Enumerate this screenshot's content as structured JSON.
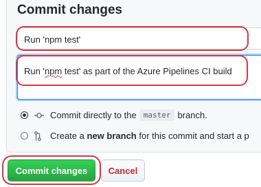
{
  "form": {
    "title": "Commit changes",
    "summary_value": "Run 'npm test'",
    "description_prefix": "Run '",
    "description_misspelled": "npm",
    "description_suffix": " test' as part of the Azure Pipelines CI build"
  },
  "options": {
    "direct": {
      "prefix": "Commit directly to the",
      "branch": "master",
      "suffix": "branch.",
      "checked": true
    },
    "new_branch": {
      "prefix": "Create a",
      "bold": "new branch",
      "suffix": "for this commit and start a p",
      "checked": false
    }
  },
  "buttons": {
    "commit_label": "Commit changes",
    "cancel_label": "Cancel"
  },
  "colors": {
    "highlight": "#d9363e",
    "primary": "#28a745",
    "danger": "#cb2431",
    "focus": "#2188ff"
  }
}
